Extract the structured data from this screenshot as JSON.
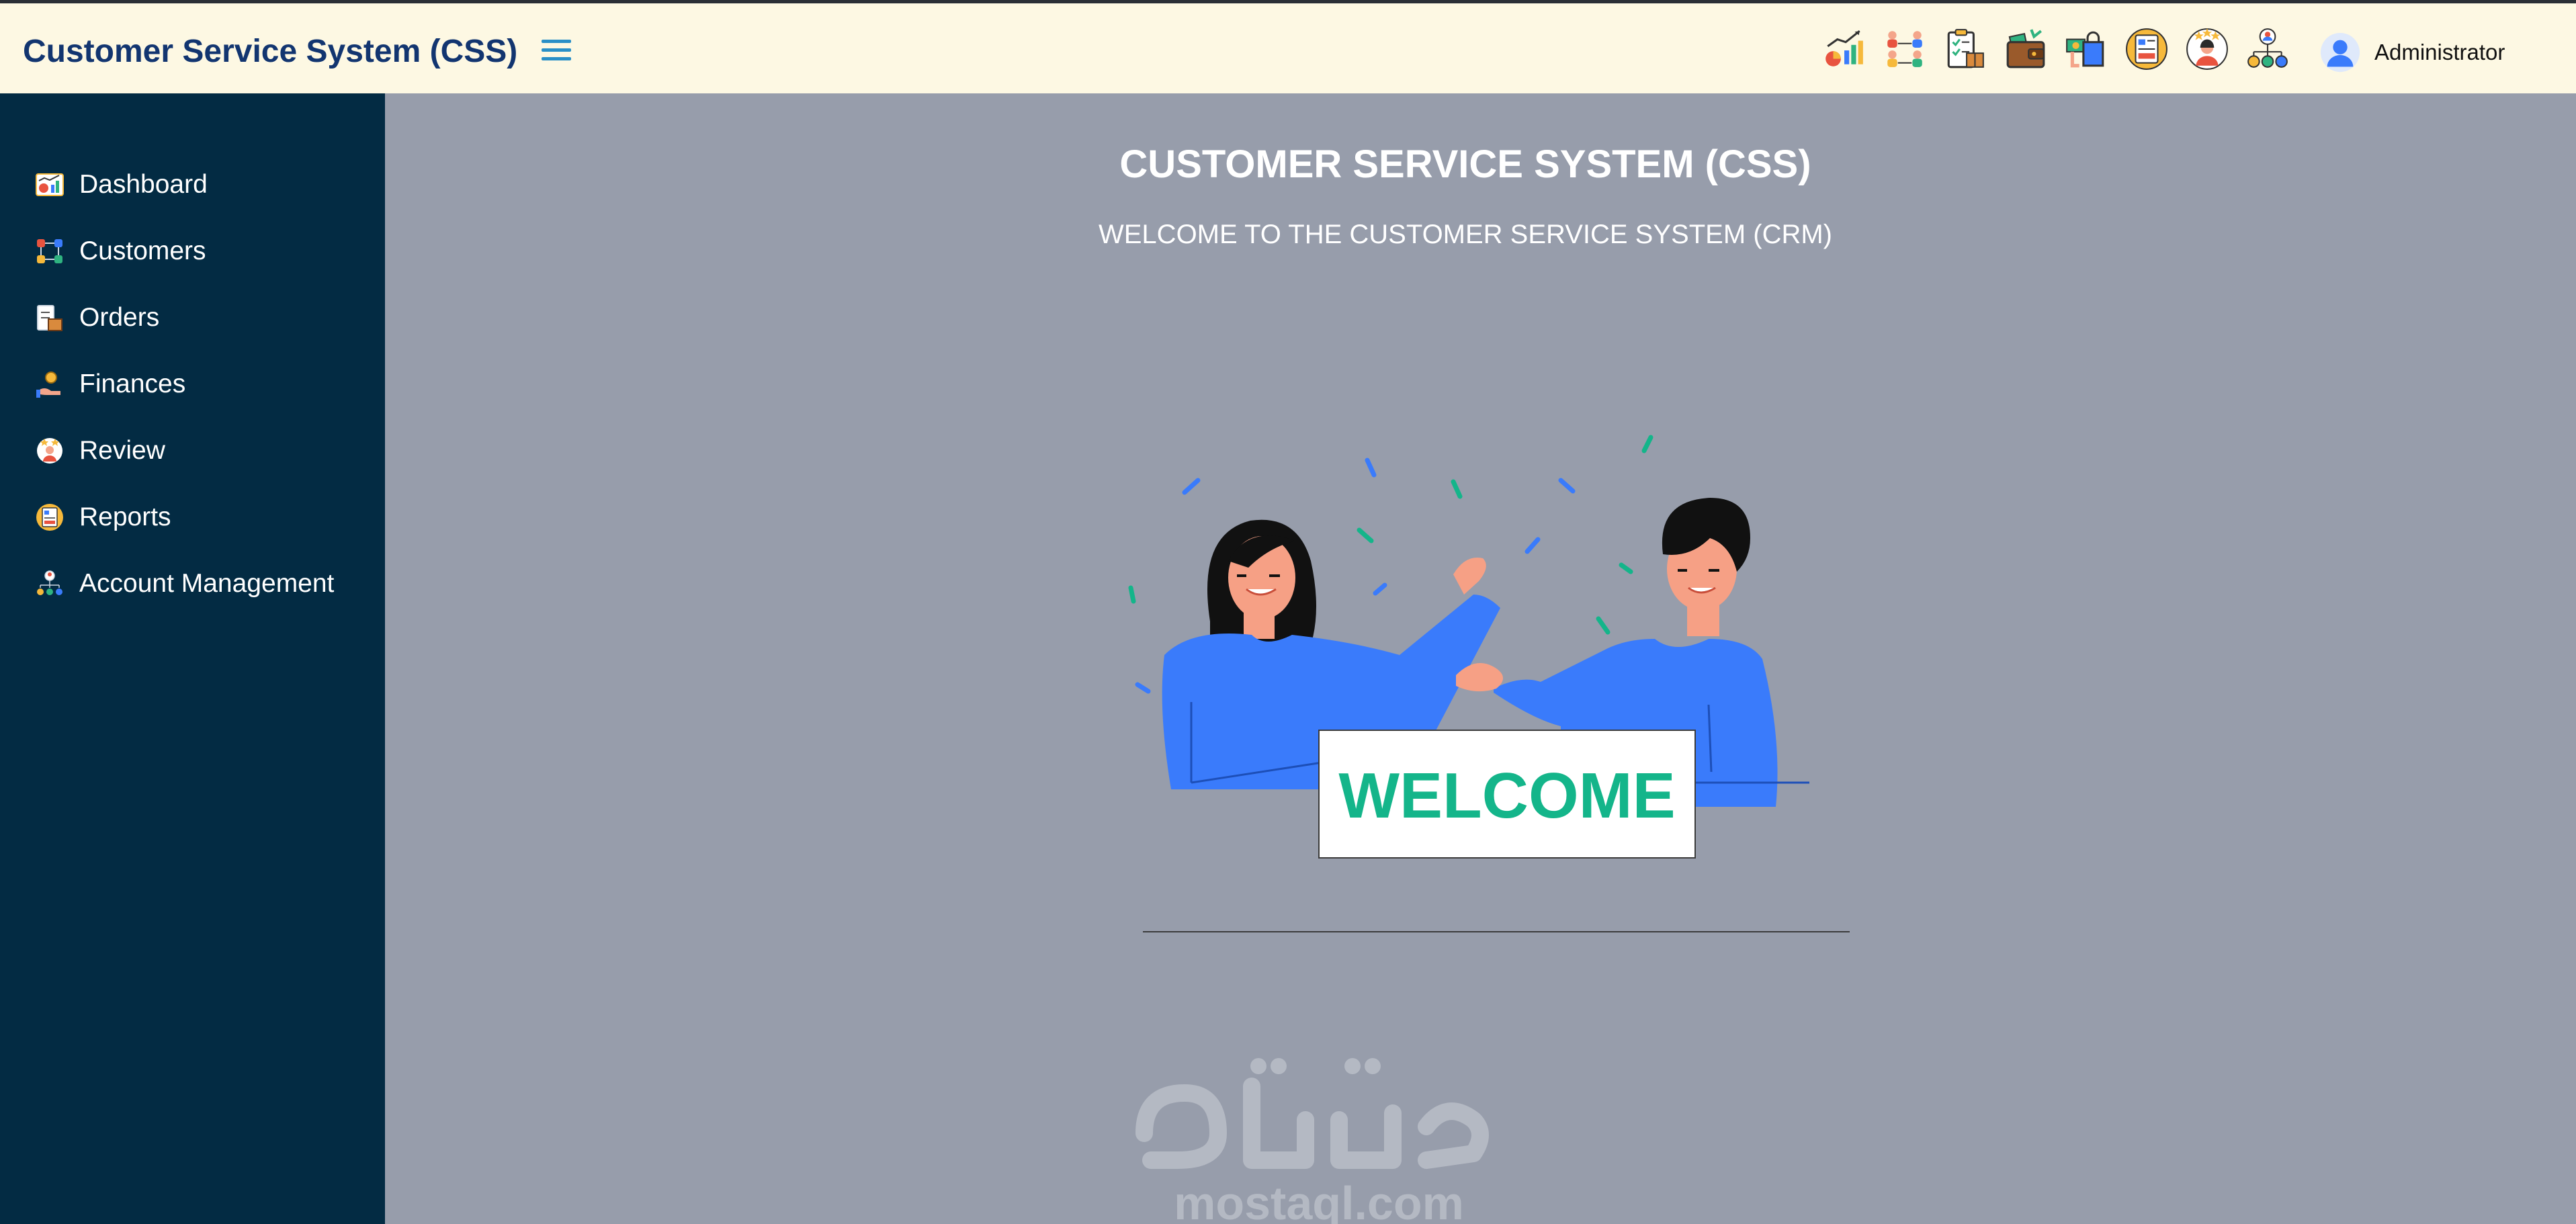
{
  "header": {
    "brand": "Customer Service System (CSS)",
    "menu_icon": "hamburger-menu-icon",
    "toolbar_icons": [
      "dashboard-chart-icon",
      "customers-network-icon",
      "orders-clipboard-icon",
      "finances-wallet-icon",
      "shopping-bag-icon",
      "reports-book-icon",
      "review-rating-icon",
      "account-hierarchy-icon"
    ],
    "user": {
      "avatar_icon": "user-avatar-icon",
      "name": "Administrator"
    }
  },
  "sidebar": {
    "items": [
      {
        "label": "Dashboard",
        "icon": "dashboard-icon"
      },
      {
        "label": "Customers",
        "icon": "customers-icon"
      },
      {
        "label": "Orders",
        "icon": "orders-icon"
      },
      {
        "label": "Finances",
        "icon": "finances-icon"
      },
      {
        "label": "Review",
        "icon": "review-icon"
      },
      {
        "label": "Reports",
        "icon": "reports-icon"
      },
      {
        "label": "Account Management",
        "icon": "account-management-icon"
      }
    ]
  },
  "main": {
    "title": "CUSTOMER SERVICE SYSTEM (CSS)",
    "subtitle": "WELCOME TO THE CUSTOMER SERVICE SYSTEM (CRM)",
    "sign_text": "WELCOME"
  },
  "watermark": {
    "arabic": "مستقل",
    "latin": "mostaql.com"
  },
  "colors": {
    "header_bg": "#fdf8e3",
    "brand_text": "#123570",
    "hamburger": "#2a8fc7",
    "sidebar_bg": "#032b43",
    "main_bg": "#979dab",
    "figure_blue": "#3a7bfb",
    "sign_text": "#14b58a"
  }
}
